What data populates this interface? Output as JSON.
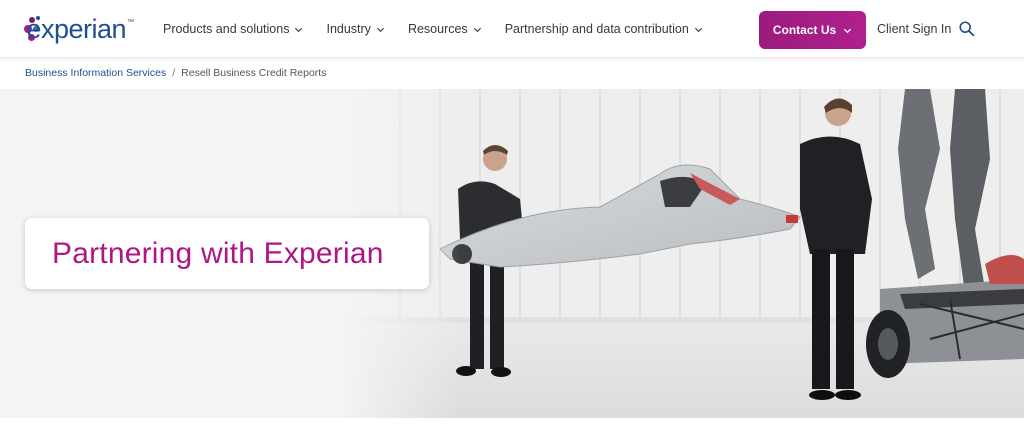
{
  "brand": {
    "name": "experian",
    "trademark": "™",
    "colors": {
      "navy": "#1d4f91",
      "magenta": "#af1685",
      "purple": "#6d2077",
      "blue": "#426da9"
    }
  },
  "nav": {
    "items": [
      {
        "label": "Products and solutions",
        "has_dropdown": true
      },
      {
        "label": "Industry",
        "has_dropdown": true
      },
      {
        "label": "Resources",
        "has_dropdown": true
      },
      {
        "label": "Partnership and data contribution",
        "has_dropdown": true
      }
    ],
    "contact_label": "Contact Us",
    "client_signin_label": "Client Sign In",
    "search_icon": "search-icon"
  },
  "breadcrumb": {
    "items": [
      {
        "label": "Business Information Services",
        "link": true
      },
      {
        "label": "Resell Business Credit Reports",
        "link": false
      }
    ],
    "separator": "/"
  },
  "hero": {
    "title": "Partnering with Experian",
    "image_subject": "two people carrying a race car body panel in a white workshop"
  }
}
